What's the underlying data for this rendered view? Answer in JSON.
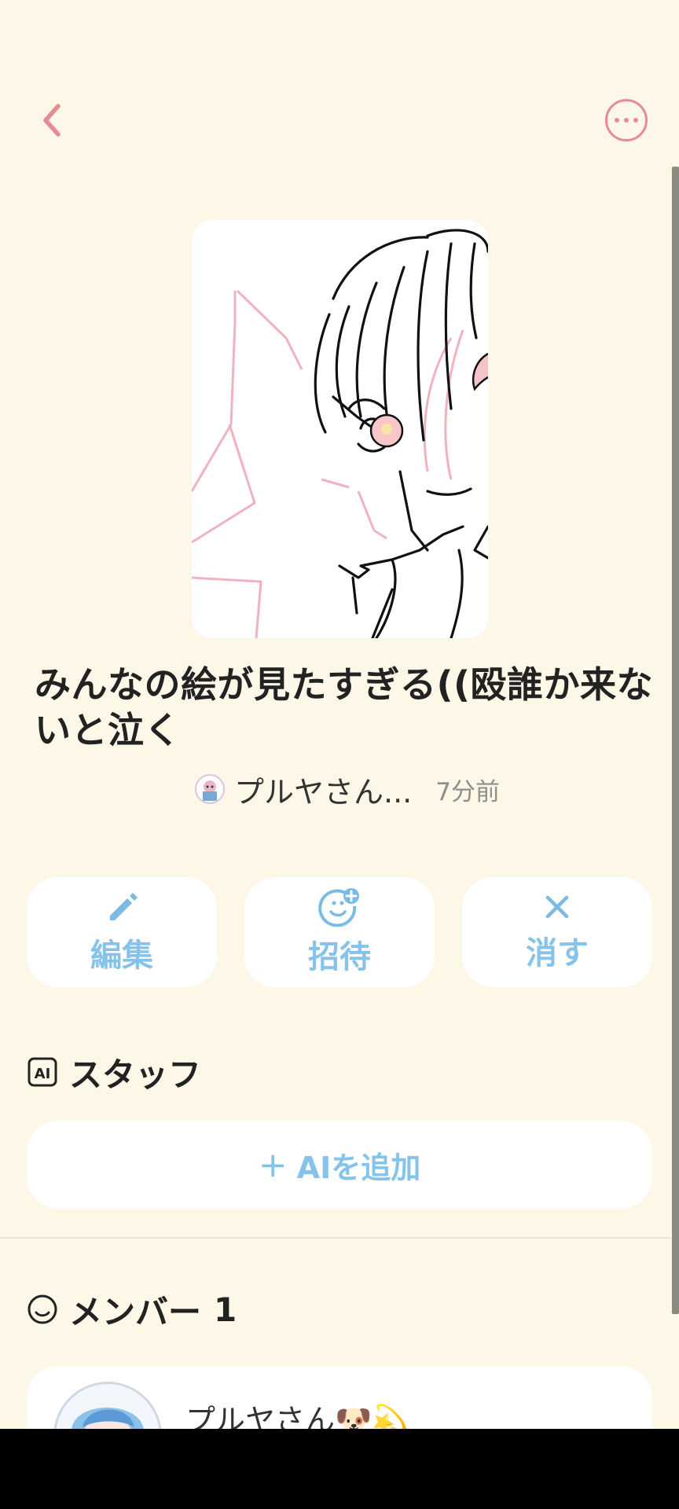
{
  "header": {
    "back_icon": "chevron-left-icon",
    "more_icon": "more-dots-icon"
  },
  "room": {
    "title": "みんなの絵が見たすぎる((殴誰か来ないと泣く",
    "author": "プルヤさん...",
    "time": "7分前"
  },
  "actions": [
    {
      "label": "編集",
      "icon": "pencil-icon"
    },
    {
      "label": "招待",
      "icon": "invite-face-plus-icon"
    },
    {
      "label": "消す",
      "icon": "close-x-icon"
    }
  ],
  "staff": {
    "heading": "スタッフ",
    "add_label": "AIを追加",
    "add_plus": "+"
  },
  "members": {
    "heading": "メンバー",
    "count": "1",
    "items": [
      {
        "name": "プルヤさん🐶💫"
      }
    ]
  },
  "colors": {
    "background": "#fdf7e8",
    "accent_pink": "#e88a95",
    "accent_blue": "#86c3ea",
    "card": "#ffffff"
  }
}
